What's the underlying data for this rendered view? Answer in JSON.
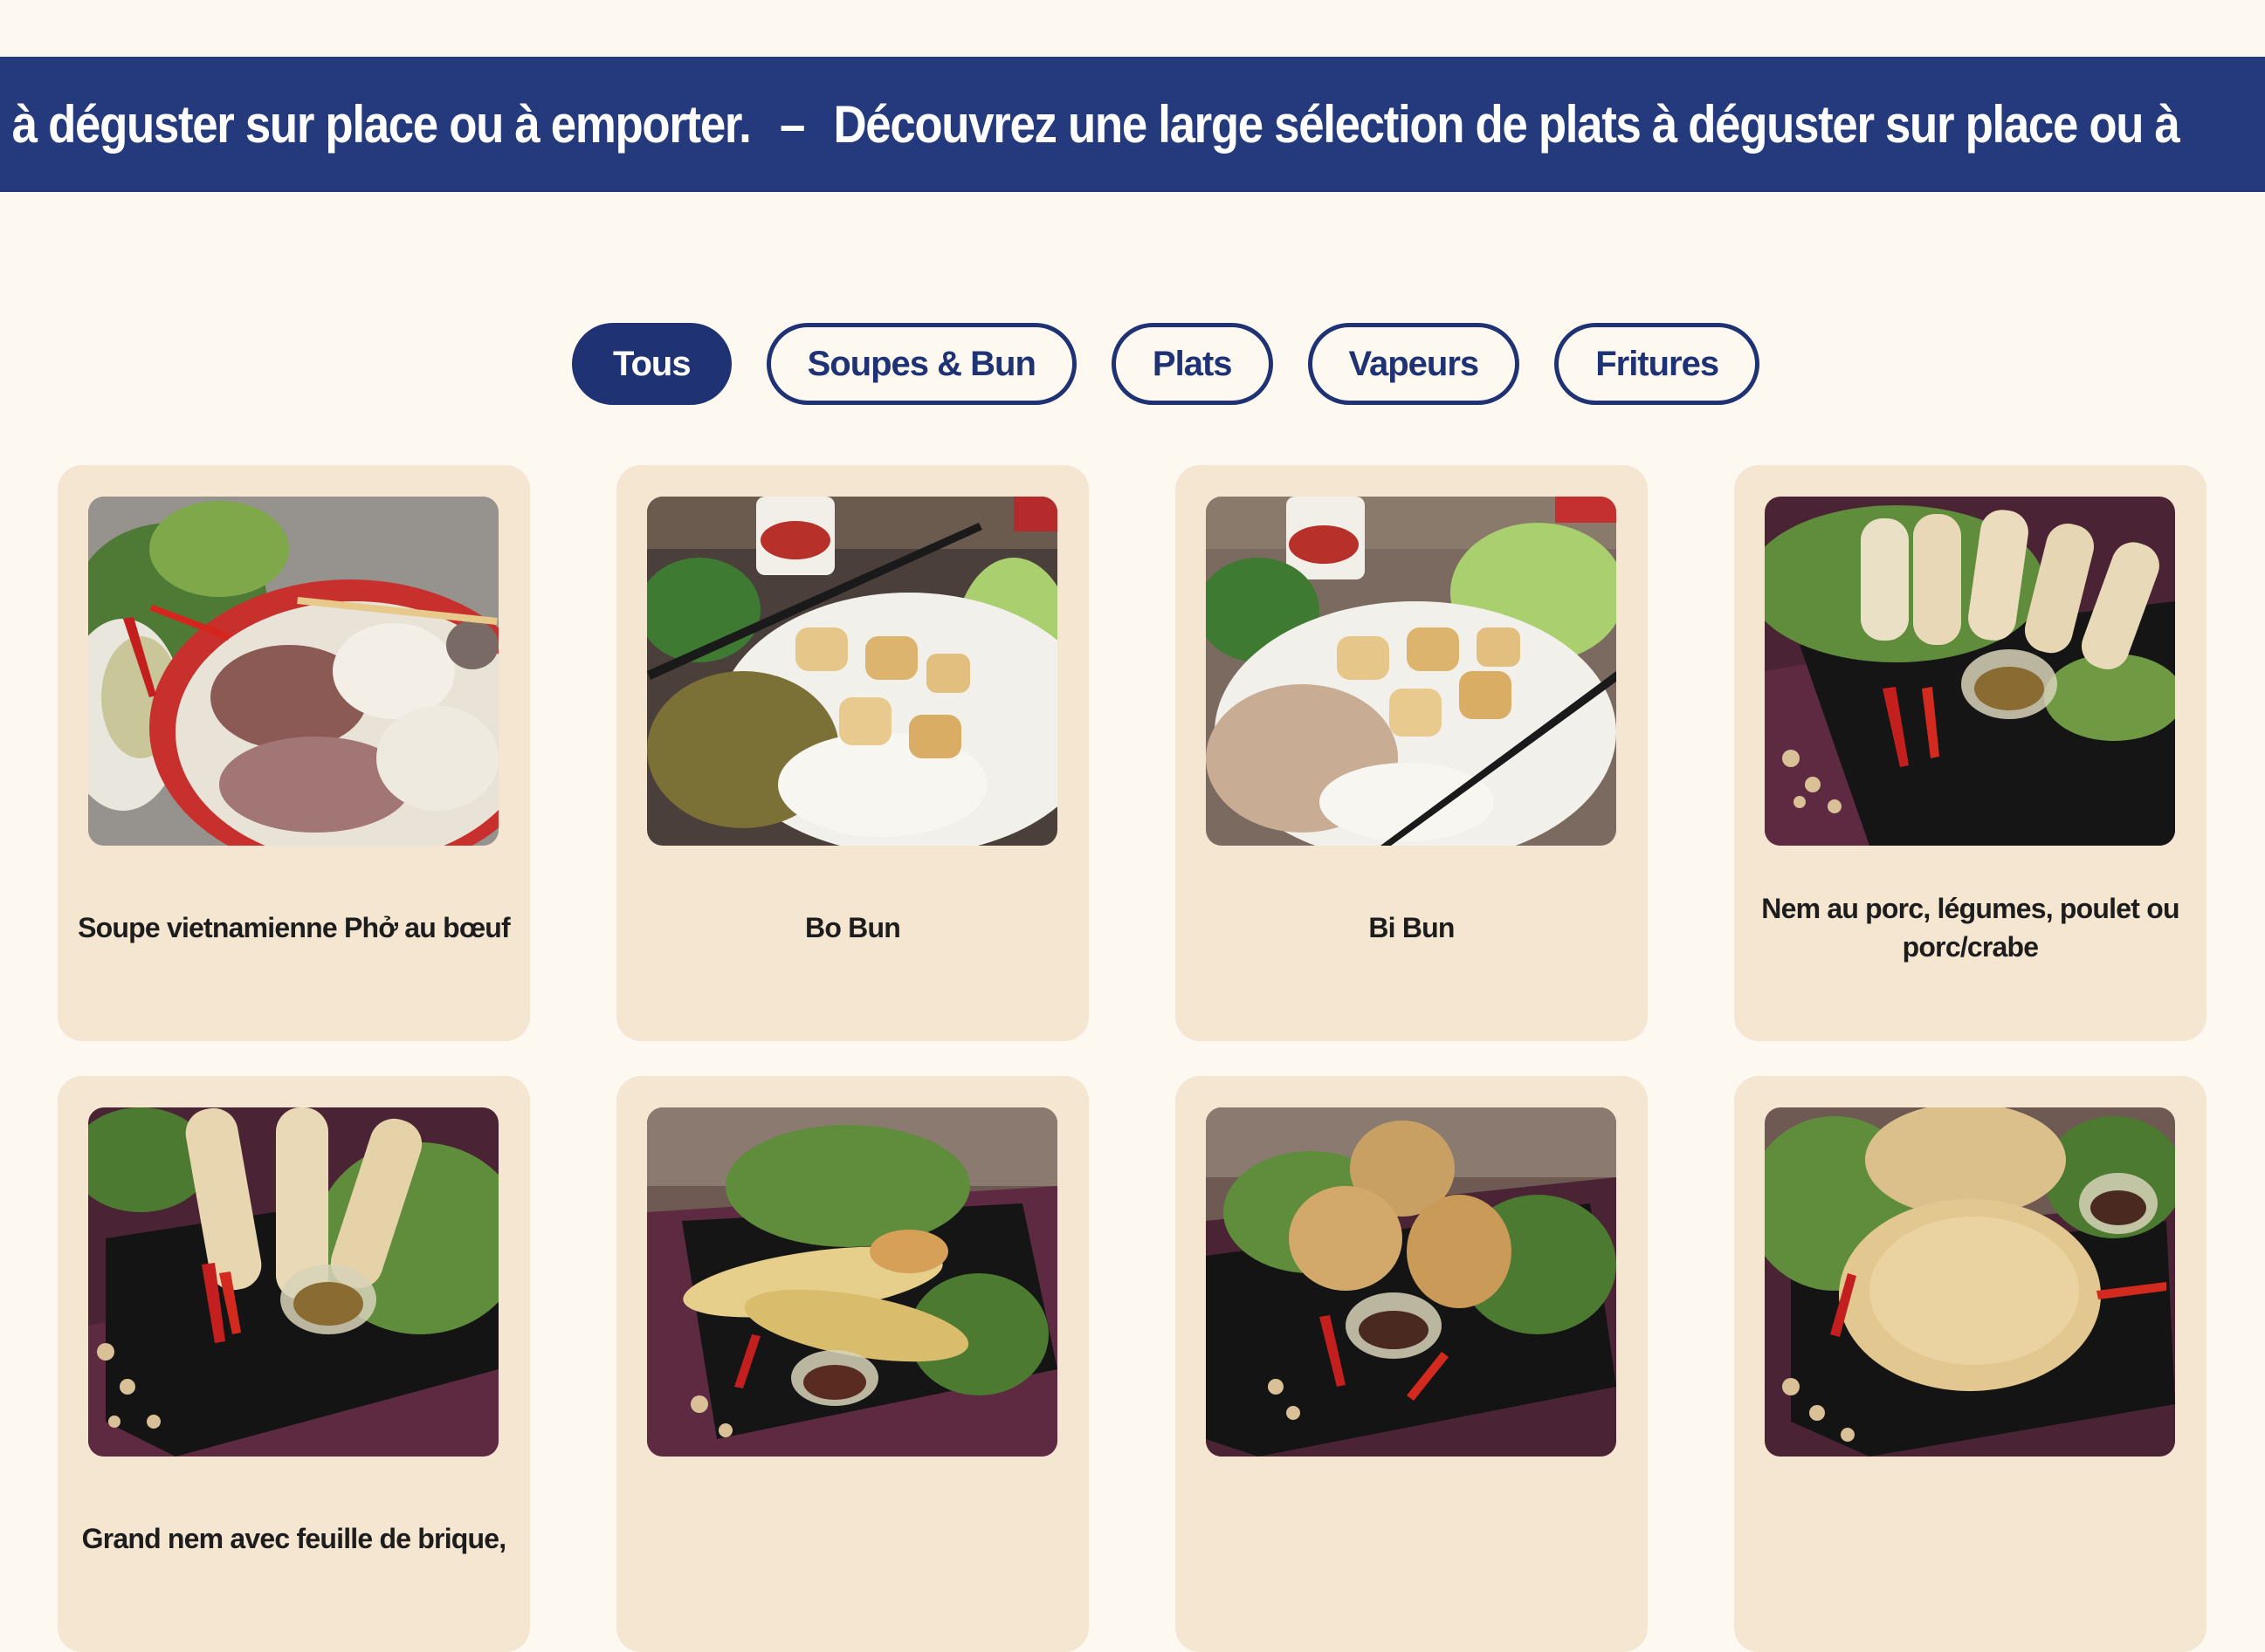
{
  "banner": {
    "text_a": "ats à déguster sur place ou à emporter.",
    "separator": "–",
    "text_b": "Découvrez une large sélection de plats à déguster sur place ou à"
  },
  "filters": [
    {
      "label": "Tous",
      "active": true
    },
    {
      "label": "Soupes & Bun",
      "active": false
    },
    {
      "label": "Plats",
      "active": false
    },
    {
      "label": "Vapeurs",
      "active": false
    },
    {
      "label": "Fritures",
      "active": false
    }
  ],
  "dishes": [
    {
      "title": "Soupe vietnamienne Phở au bœuf",
      "image": "pho-soup-photo"
    },
    {
      "title": "Bo Bun",
      "image": "bo-bun-photo"
    },
    {
      "title": "Bi Bun",
      "image": "bi-bun-photo"
    },
    {
      "title": "Nem au porc, légumes, poulet ou porc/crabe",
      "image": "nem-photo"
    },
    {
      "title": "Grand nem avec feuille de brique,",
      "image": "grand-nem-photo"
    },
    {
      "title": "",
      "image": "fried-shrimp-photo"
    },
    {
      "title": "",
      "image": "fried-dumplings-photo"
    },
    {
      "title": "",
      "image": "fried-pastry-photo"
    }
  ],
  "colors": {
    "page_bg": "#fdf9f0",
    "banner_bg": "#253a7d",
    "accent": "#1f3273",
    "card_bg": "#f5e6d2",
    "title_text": "#1d1d1d"
  }
}
